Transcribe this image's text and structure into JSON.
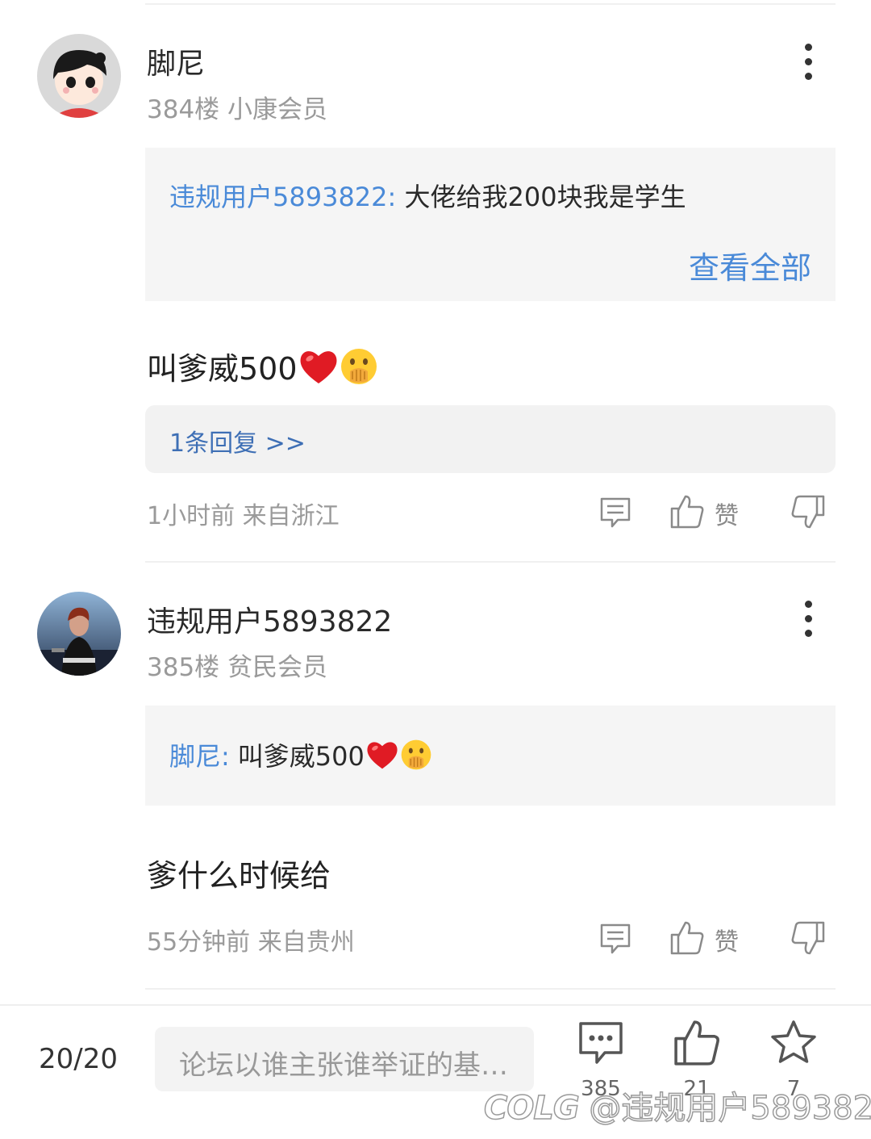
{
  "posts": [
    {
      "username": "脚尼",
      "floor": "384楼",
      "member_level": "小康会员",
      "quote_user": "违规用户5893822:",
      "quote_text": "大佬给我200块我是学生",
      "view_all": "查看全部",
      "content": "叫爹威500",
      "reply_link": "1条回复 >>",
      "time": "1小时前",
      "location": "来自浙江",
      "like_label": "赞"
    },
    {
      "username": "违规用户5893822",
      "floor": "385楼",
      "member_level": "贫民会员",
      "quote_user": "脚尼:",
      "quote_text": "叫爹威500",
      "content": "爹什么时候给",
      "time": "55分钟前",
      "location": "来自贵州",
      "like_label": "赞"
    }
  ],
  "bottom_bar": {
    "page_indicator": "20/20",
    "input_placeholder": "论坛以谁主张谁举证的基…",
    "comment_count": "385",
    "like_count": "21",
    "favorite_count": "7"
  },
  "watermark": {
    "logo": "COLG",
    "handle": "@违规用户5893822"
  },
  "colors": {
    "link_blue": "#4a8ad8",
    "reply_blue": "#3e6fb5",
    "meta_gray": "#9a9a9a",
    "quote_bg": "#f5f5f5"
  }
}
